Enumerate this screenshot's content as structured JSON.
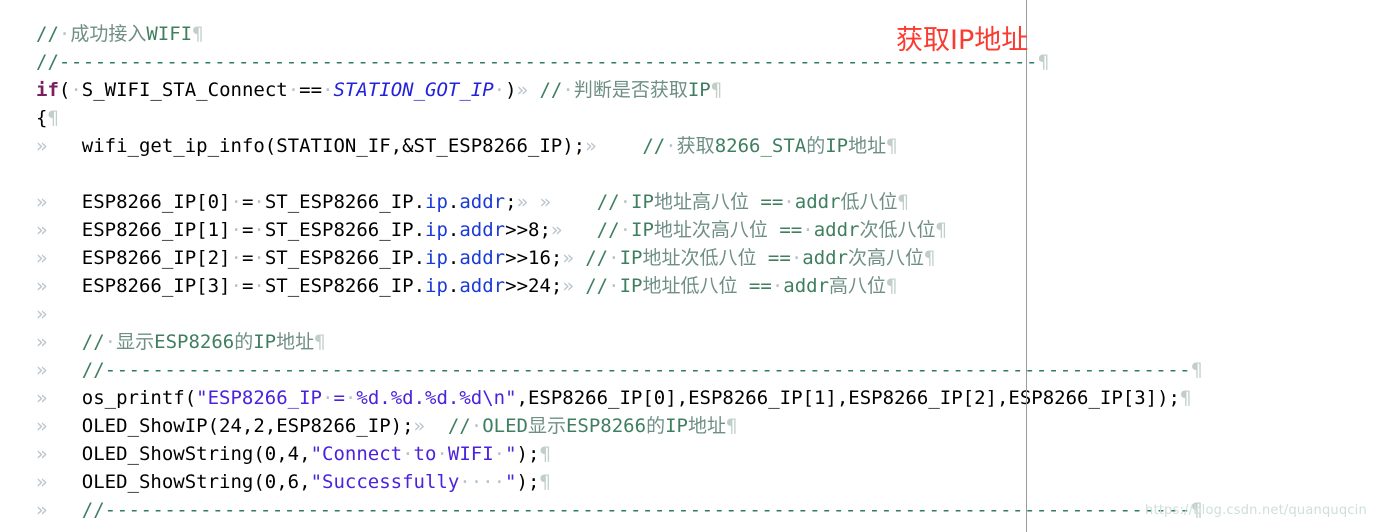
{
  "document": {
    "kind": "code-editor-screenshot",
    "language": "C",
    "show_formatting_marks": true
  },
  "colors": {
    "background": "#ffffff",
    "text": "#000000",
    "keyword": "#7b1f5e",
    "macro": "#2222dd",
    "string": "#4b22dd",
    "member": "#1a3ad6",
    "comment": "#3f7f5f",
    "comment_cjk": "#6f8f86",
    "tab_mark": "#b9c4cc",
    "pilcrow": "#c2cfc9",
    "annotation_red": "#fb3b30",
    "page_guide": "#9a9a9a",
    "watermark": "#cfe0d7"
  },
  "marks": {
    "tab": "»",
    "space": "·",
    "paragraph": "¶"
  },
  "annotation": {
    "text": "获取IP地址"
  },
  "watermark": {
    "text": "https://blog.csdn.net/quanquqcin"
  },
  "code": {
    "lines": [
      {
        "id": "l1",
        "indent": "",
        "code": "",
        "comment": "// · 成功接入WIFI",
        "full": "//·成功接入WIFI¶"
      },
      {
        "id": "l2",
        "indent": "",
        "code": "",
        "comment": "//----------------------------------------------------------------------------",
        "full": "//----------------------------------------------------------------------------¶"
      },
      {
        "id": "l3",
        "indent": "",
        "code": "if(·S_WIFI_STA_Connect·==·STATION_GOT_IP·)",
        "comment": "//·判断是否获取IP",
        "keyword": "if",
        "macro": "STATION_GOT_IP",
        "full": "if(·S_WIFI_STA_Connect·==·STATION_GOT_IP·)» //·判断是否获取IP¶"
      },
      {
        "id": "l4",
        "indent": "",
        "code": "{",
        "comment": "",
        "full": "{¶"
      },
      {
        "id": "l5",
        "indent": "»",
        "code": "wifi_get_ip_info(STATION_IF,&ST_ESP8266_IP);",
        "comment": "//·获取8266_STA的IP地址",
        "full": "»   wifi_get_ip_info(STATION_IF,&ST_ESP8266_IP);»    //·获取8266_STA的IP地址¶"
      },
      {
        "id": "l6",
        "indent": "",
        "code": "",
        "comment": "",
        "full": ""
      },
      {
        "id": "l7",
        "indent": "»",
        "code": "ESP8266_IP[0]·=·ST_ESP8266_IP.ip.addr;",
        "comment": "//·IP地址高八位 ==·addr低八位",
        "member": ".ip.addr",
        "full": "»   ESP8266_IP[0]·=·ST_ESP8266_IP.ip.addr;» »    //·IP地址高八位 ==·addr低八位¶"
      },
      {
        "id": "l8",
        "indent": "»",
        "code": "ESP8266_IP[1]·=·ST_ESP8266_IP.ip.addr>>8;",
        "comment": "//·IP地址次高八位 ==·addr次低八位",
        "member": ".ip.addr",
        "full": "»   ESP8266_IP[1]·=·ST_ESP8266_IP.ip.addr>>8;»   //·IP地址次高八位 ==·addr次低八位¶"
      },
      {
        "id": "l9",
        "indent": "»",
        "code": "ESP8266_IP[2]·=·ST_ESP8266_IP.ip.addr>>16;",
        "comment": "//·IP地址次低八位 ==·addr次高八位",
        "member": ".ip.addr",
        "full": "»   ESP8266_IP[2]·=·ST_ESP8266_IP.ip.addr>>16;» //·IP地址次低八位 ==·addr次高八位¶"
      },
      {
        "id": "l10",
        "indent": "»",
        "code": "ESP8266_IP[3]·=·ST_ESP8266_IP.ip.addr>>24;",
        "comment": "//·IP地址低八位 ==·addr高八位",
        "member": ".ip.addr",
        "full": "»   ESP8266_IP[3]·=·ST_ESP8266_IP.ip.addr>>24;» //·IP地址低八位 ==·addr高八位¶"
      },
      {
        "id": "l11",
        "indent": "",
        "code": "",
        "comment": "",
        "full": ""
      },
      {
        "id": "l12",
        "indent": "»",
        "code": "",
        "comment": "//·显示ESP8266的IP地址",
        "full": "»   //·显示ESP8266的IP地址¶"
      },
      {
        "id": "l13",
        "indent": "»",
        "code": "",
        "comment": "//----------------------------------------------------------------------------------------",
        "full": "»   //----------------------------------------------------------------------------------------¶"
      },
      {
        "id": "l14",
        "indent": "»",
        "code": "os_printf(\"ESP8266_IP·=·%d.%d.%d.%d\\n\",ESP8266_IP[0],ESP8266_IP[1],ESP8266_IP[2],ESP8266_IP[3]);",
        "comment": "",
        "string": "\"ESP8266_IP·=·%d.%d.%d.%d\\n\"",
        "full": "»   os_printf(\"ESP8266_IP·=·%d.%d.%d.%d\\n\",ESP8266_IP[0],ESP8266_IP[1],ESP8266_IP[2],ESP8266_IP[3]);¶"
      },
      {
        "id": "l15",
        "indent": "»",
        "code": "OLED_ShowIP(24,2,ESP8266_IP);",
        "comment": "//·OLED显示ESP8266的IP地址",
        "full": "»   OLED_ShowIP(24,2,ESP8266_IP);»  //·OLED显示ESP8266的IP地址¶"
      },
      {
        "id": "l16",
        "indent": "»",
        "code": "OLED_ShowString(0,4,\"Connect·to·WIFI·\");",
        "comment": "",
        "string": "\"Connect·to·WIFI·\"",
        "full": "»   OLED_ShowString(0,4,\"Connect·to·WIFI·\");¶"
      },
      {
        "id": "l17",
        "indent": "»",
        "code": "OLED_ShowString(0,6,\"Successfully····\");",
        "comment": "",
        "string": "\"Successfully····\"",
        "full": "»   OLED_ShowString(0,6,\"Successfully····\");¶"
      },
      {
        "id": "l18",
        "indent": "»",
        "code": "",
        "comment": "//----------------------------------------------------------------------------------------",
        "full": "»   //----------------------------------------------------------------------------------------¶"
      }
    ],
    "segments": {
      "l1": [
        {
          "t": "//",
          "c": "cmt"
        },
        {
          "t": "·",
          "c": "dot"
        },
        {
          "t": "成功接入",
          "c": "cmt-cn"
        },
        {
          "t": "WIFI",
          "c": "cmt"
        },
        {
          "t": "¶",
          "c": "pilcrow"
        }
      ],
      "l2": [
        {
          "t": "//",
          "c": "cmt"
        },
        {
          "t": "----------------------------------------------------------------------------------",
          "c": "cmt-dash"
        },
        {
          "t": "¶",
          "c": "pilcrow"
        }
      ],
      "l3": [
        {
          "t": "if",
          "c": "kw"
        },
        {
          "t": "(",
          "c": "plain"
        },
        {
          "t": "·",
          "c": "dot"
        },
        {
          "t": "S_WIFI_STA_Connect",
          "c": "plain"
        },
        {
          "t": "·",
          "c": "dot"
        },
        {
          "t": "==",
          "c": "plain"
        },
        {
          "t": "·",
          "c": "dot"
        },
        {
          "t": "STATION_GOT_IP",
          "c": "macro"
        },
        {
          "t": "·",
          "c": "dot"
        },
        {
          "t": ")",
          "c": "plain"
        },
        {
          "t": "»",
          "c": "tab"
        },
        {
          "t": " ",
          "c": "plain"
        },
        {
          "t": "//",
          "c": "cmt"
        },
        {
          "t": "·",
          "c": "dot"
        },
        {
          "t": "判断是否获取",
          "c": "cmt-cn"
        },
        {
          "t": "IP",
          "c": "cmt"
        },
        {
          "t": "¶",
          "c": "pilcrow"
        }
      ],
      "l4": [
        {
          "t": "{",
          "c": "plain"
        },
        {
          "t": "¶",
          "c": "pilcrow"
        }
      ],
      "l5": [
        {
          "t": "»",
          "c": "tab"
        },
        {
          "t": "   ",
          "c": "plain"
        },
        {
          "t": "wifi_get_ip_info(STATION_IF,&ST_ESP8266_IP);",
          "c": "plain"
        },
        {
          "t": "»",
          "c": "tab"
        },
        {
          "t": "    ",
          "c": "plain"
        },
        {
          "t": "//",
          "c": "cmt"
        },
        {
          "t": "·",
          "c": "dot"
        },
        {
          "t": "获取",
          "c": "cmt-cn"
        },
        {
          "t": "8266_STA",
          "c": "cmt"
        },
        {
          "t": "的",
          "c": "cmt-cn"
        },
        {
          "t": "IP",
          "c": "cmt"
        },
        {
          "t": "地址",
          "c": "cmt-cn"
        },
        {
          "t": "¶",
          "c": "pilcrow"
        }
      ],
      "l6": [],
      "l7": [
        {
          "t": "»",
          "c": "tab"
        },
        {
          "t": "   ",
          "c": "plain"
        },
        {
          "t": "ESP8266_IP[0]",
          "c": "plain"
        },
        {
          "t": "·",
          "c": "dot"
        },
        {
          "t": "=",
          "c": "plain"
        },
        {
          "t": "·",
          "c": "dot"
        },
        {
          "t": "ST_ESP8266_IP.",
          "c": "plain"
        },
        {
          "t": "ip",
          "c": "member"
        },
        {
          "t": ".",
          "c": "plain"
        },
        {
          "t": "addr",
          "c": "member"
        },
        {
          "t": ";",
          "c": "plain"
        },
        {
          "t": "»",
          "c": "tab"
        },
        {
          "t": " ",
          "c": "plain"
        },
        {
          "t": "»",
          "c": "tab"
        },
        {
          "t": "    ",
          "c": "plain"
        },
        {
          "t": "//",
          "c": "cmt"
        },
        {
          "t": "·",
          "c": "dot"
        },
        {
          "t": "IP",
          "c": "cmt"
        },
        {
          "t": "地址",
          "c": "cmt-cn"
        },
        {
          "t": "高八位",
          "c": "cmt-cn"
        },
        {
          "t": " ==",
          "c": "cmt"
        },
        {
          "t": "·",
          "c": "dot"
        },
        {
          "t": "addr",
          "c": "cmt"
        },
        {
          "t": "低八位",
          "c": "cmt-cn"
        },
        {
          "t": "¶",
          "c": "pilcrow"
        }
      ],
      "l8": [
        {
          "t": "»",
          "c": "tab"
        },
        {
          "t": "   ",
          "c": "plain"
        },
        {
          "t": "ESP8266_IP[1]",
          "c": "plain"
        },
        {
          "t": "·",
          "c": "dot"
        },
        {
          "t": "=",
          "c": "plain"
        },
        {
          "t": "·",
          "c": "dot"
        },
        {
          "t": "ST_ESP8266_IP.",
          "c": "plain"
        },
        {
          "t": "ip",
          "c": "member"
        },
        {
          "t": ".",
          "c": "plain"
        },
        {
          "t": "addr",
          "c": "member"
        },
        {
          "t": ">>8;",
          "c": "plain"
        },
        {
          "t": "»",
          "c": "tab"
        },
        {
          "t": "   ",
          "c": "plain"
        },
        {
          "t": "//",
          "c": "cmt"
        },
        {
          "t": "·",
          "c": "dot"
        },
        {
          "t": "IP",
          "c": "cmt"
        },
        {
          "t": "地址次高八位",
          "c": "cmt-cn"
        },
        {
          "t": " ==",
          "c": "cmt"
        },
        {
          "t": "·",
          "c": "dot"
        },
        {
          "t": "addr",
          "c": "cmt"
        },
        {
          "t": "次低八位",
          "c": "cmt-cn"
        },
        {
          "t": "¶",
          "c": "pilcrow"
        }
      ],
      "l9": [
        {
          "t": "»",
          "c": "tab"
        },
        {
          "t": "   ",
          "c": "plain"
        },
        {
          "t": "ESP8266_IP[2]",
          "c": "plain"
        },
        {
          "t": "·",
          "c": "dot"
        },
        {
          "t": "=",
          "c": "plain"
        },
        {
          "t": "·",
          "c": "dot"
        },
        {
          "t": "ST_ESP8266_IP.",
          "c": "plain"
        },
        {
          "t": "ip",
          "c": "member"
        },
        {
          "t": ".",
          "c": "plain"
        },
        {
          "t": "addr",
          "c": "member"
        },
        {
          "t": ">>16;",
          "c": "plain"
        },
        {
          "t": "»",
          "c": "tab"
        },
        {
          "t": " ",
          "c": "plain"
        },
        {
          "t": "//",
          "c": "cmt"
        },
        {
          "t": "·",
          "c": "dot"
        },
        {
          "t": "IP",
          "c": "cmt"
        },
        {
          "t": "地址次低八位",
          "c": "cmt-cn"
        },
        {
          "t": " ==",
          "c": "cmt"
        },
        {
          "t": "·",
          "c": "dot"
        },
        {
          "t": "addr",
          "c": "cmt"
        },
        {
          "t": "次高八位",
          "c": "cmt-cn"
        },
        {
          "t": "¶",
          "c": "pilcrow"
        }
      ],
      "l10": [
        {
          "t": "»",
          "c": "tab"
        },
        {
          "t": "   ",
          "c": "plain"
        },
        {
          "t": "ESP8266_IP[3]",
          "c": "plain"
        },
        {
          "t": "·",
          "c": "dot"
        },
        {
          "t": "=",
          "c": "plain"
        },
        {
          "t": "·",
          "c": "dot"
        },
        {
          "t": "ST_ESP8266_IP.",
          "c": "plain"
        },
        {
          "t": "ip",
          "c": "member"
        },
        {
          "t": ".",
          "c": "plain"
        },
        {
          "t": "addr",
          "c": "member"
        },
        {
          "t": ">>24;",
          "c": "plain"
        },
        {
          "t": "»",
          "c": "tab"
        },
        {
          "t": " ",
          "c": "plain"
        },
        {
          "t": "//",
          "c": "cmt"
        },
        {
          "t": "·",
          "c": "dot"
        },
        {
          "t": "IP",
          "c": "cmt"
        },
        {
          "t": "地址低八位",
          "c": "cmt-cn"
        },
        {
          "t": " ==",
          "c": "cmt"
        },
        {
          "t": "·",
          "c": "dot"
        },
        {
          "t": "addr",
          "c": "cmt"
        },
        {
          "t": "高八位",
          "c": "cmt-cn"
        },
        {
          "t": "¶",
          "c": "pilcrow"
        }
      ],
      "l11": [
        {
          "t": "»",
          "c": "tab"
        }
      ],
      "l12": [
        {
          "t": "»",
          "c": "tab"
        },
        {
          "t": "   ",
          "c": "plain"
        },
        {
          "t": "//",
          "c": "cmt"
        },
        {
          "t": "·",
          "c": "dot"
        },
        {
          "t": "显示",
          "c": "cmt-cn"
        },
        {
          "t": "ESP8266",
          "c": "cmt"
        },
        {
          "t": "的",
          "c": "cmt-cn"
        },
        {
          "t": "IP",
          "c": "cmt"
        },
        {
          "t": "地址",
          "c": "cmt-cn"
        },
        {
          "t": "¶",
          "c": "pilcrow"
        }
      ],
      "l13": [
        {
          "t": "»",
          "c": "tab"
        },
        {
          "t": "   ",
          "c": "plain"
        },
        {
          "t": "//",
          "c": "cmt"
        },
        {
          "t": "-------------------------------------------------------------------------------------------",
          "c": "cmt-dash"
        },
        {
          "t": "¶",
          "c": "pilcrow"
        }
      ],
      "l14": [
        {
          "t": "»",
          "c": "tab"
        },
        {
          "t": "   ",
          "c": "plain"
        },
        {
          "t": "os_printf(",
          "c": "plain"
        },
        {
          "t": "\"ESP8266_IP",
          "c": "str"
        },
        {
          "t": "·",
          "c": "dot"
        },
        {
          "t": "=",
          "c": "str"
        },
        {
          "t": "·",
          "c": "dot"
        },
        {
          "t": "%d.%d.%d.%d\\n\"",
          "c": "str"
        },
        {
          "t": ",ESP8266_IP[0],ESP8266_IP[1],ESP8266_IP[2],ESP8266_IP[3]);",
          "c": "plain"
        },
        {
          "t": "¶",
          "c": "pilcrow"
        }
      ],
      "l15": [
        {
          "t": "»",
          "c": "tab"
        },
        {
          "t": "   ",
          "c": "plain"
        },
        {
          "t": "OLED_ShowIP(24,2,ESP8266_IP);",
          "c": "plain"
        },
        {
          "t": "»",
          "c": "tab"
        },
        {
          "t": "  ",
          "c": "plain"
        },
        {
          "t": "//",
          "c": "cmt"
        },
        {
          "t": "·",
          "c": "dot"
        },
        {
          "t": "OLED",
          "c": "cmt"
        },
        {
          "t": "显示",
          "c": "cmt-cn"
        },
        {
          "t": "ESP8266",
          "c": "cmt"
        },
        {
          "t": "的",
          "c": "cmt-cn"
        },
        {
          "t": "IP",
          "c": "cmt"
        },
        {
          "t": "地址",
          "c": "cmt-cn"
        },
        {
          "t": "¶",
          "c": "pilcrow"
        }
      ],
      "l16": [
        {
          "t": "»",
          "c": "tab"
        },
        {
          "t": "   ",
          "c": "plain"
        },
        {
          "t": "OLED_ShowString(0,4,",
          "c": "plain"
        },
        {
          "t": "\"Connect",
          "c": "str"
        },
        {
          "t": "·",
          "c": "dot"
        },
        {
          "t": "to",
          "c": "str"
        },
        {
          "t": "·",
          "c": "dot"
        },
        {
          "t": "WIFI",
          "c": "str"
        },
        {
          "t": "·",
          "c": "dot"
        },
        {
          "t": "\"",
          "c": "str"
        },
        {
          "t": ");",
          "c": "plain"
        },
        {
          "t": "¶",
          "c": "pilcrow"
        }
      ],
      "l17": [
        {
          "t": "»",
          "c": "tab"
        },
        {
          "t": "   ",
          "c": "plain"
        },
        {
          "t": "OLED_ShowString(0,6,",
          "c": "plain"
        },
        {
          "t": "\"Successfully",
          "c": "str"
        },
        {
          "t": "····",
          "c": "dot"
        },
        {
          "t": "\"",
          "c": "str"
        },
        {
          "t": ");",
          "c": "plain"
        },
        {
          "t": "¶",
          "c": "pilcrow"
        }
      ],
      "l18": [
        {
          "t": "»",
          "c": "tab"
        },
        {
          "t": "   ",
          "c": "plain"
        },
        {
          "t": "//",
          "c": "cmt"
        },
        {
          "t": "-------------------------------------------------------------------------------------------",
          "c": "cmt-dash"
        },
        {
          "t": "¶",
          "c": "pilcrow"
        }
      ]
    }
  }
}
